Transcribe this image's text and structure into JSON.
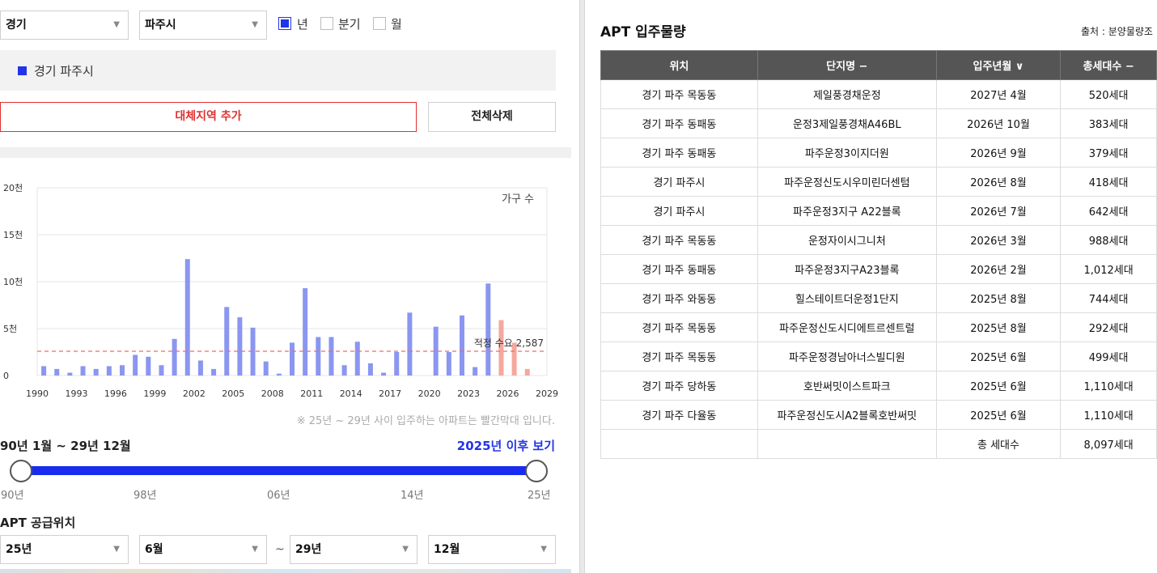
{
  "filters": {
    "province": "경기",
    "city": "파주시",
    "period_options": [
      {
        "label": "년",
        "checked": true
      },
      {
        "label": "분기",
        "checked": false
      },
      {
        "label": "월",
        "checked": false
      }
    ]
  },
  "selected_region": "경기 파주시",
  "buttons": {
    "add_region": "대체지역 추가",
    "delete_all": "전체삭제"
  },
  "chart_data": {
    "type": "bar",
    "series_label": "가구 수",
    "y_tick_labels": [
      "0",
      "5천",
      "10천",
      "15천",
      "20천"
    ],
    "ylim": [
      0,
      20000
    ],
    "x_tick_labels": [
      "1990",
      "1993",
      "1996",
      "1999",
      "2002",
      "2005",
      "2008",
      "2011",
      "2014",
      "2017",
      "2020",
      "2023",
      "2026",
      "2029"
    ],
    "xlim": [
      1990,
      2029
    ],
    "x": [
      1990,
      1991,
      1992,
      1993,
      1994,
      1995,
      1996,
      1997,
      1998,
      1999,
      2000,
      2001,
      2002,
      2003,
      2004,
      2005,
      2006,
      2007,
      2008,
      2009,
      2010,
      2011,
      2012,
      2013,
      2014,
      2015,
      2016,
      2017,
      2018,
      2019,
      2020,
      2021,
      2022,
      2023,
      2024,
      2025,
      2026,
      2027
    ],
    "values": [
      1000,
      700,
      300,
      1000,
      700,
      1000,
      1100,
      2200,
      2000,
      1100,
      3900,
      12400,
      1600,
      700,
      7300,
      6200,
      5100,
      1500,
      200,
      3500,
      9300,
      4100,
      4100,
      1100,
      3600,
      1300,
      300,
      2500,
      6700,
      0,
      5200,
      2500,
      6400,
      900,
      9800,
      5900,
      3500,
      700
    ],
    "colors": {
      "before_2025": "#8a96f0",
      "from_2025": "#f5a89c",
      "threshold": "#f06a6a"
    },
    "threshold": {
      "label": "적정 수요 2,587",
      "value": 2587
    }
  },
  "note": "※ 25년 ~ 29년 사이 입주하는 아파트는 빨간막대 입니다.",
  "range": {
    "title": "90년 1월 ~ 29년 12월",
    "link": "2025년 이후 보기",
    "tick_labels": [
      "90년",
      "98년",
      "06년",
      "14년",
      "25년"
    ]
  },
  "supply": {
    "title": "APT 공급위치",
    "start_year": "25년",
    "start_month": "6월",
    "tilde": "~",
    "end_year": "29년",
    "end_month": "12월"
  },
  "apt": {
    "title": "APT 입주물량",
    "source": "출처 : 분양물량조",
    "columns": [
      "위치",
      "단지명 −",
      "입주년월 ∨",
      "총세대수 −"
    ],
    "rows": [
      [
        "경기 파주 목동동",
        "제일풍경채운정",
        "2027년 4월",
        "520세대"
      ],
      [
        "경기 파주 동패동",
        "운정3제일풍경채A46BL",
        "2026년 10월",
        "383세대"
      ],
      [
        "경기 파주 동패동",
        "파주운정3이지더원",
        "2026년 9월",
        "379세대"
      ],
      [
        "경기 파주시",
        "파주운정신도시우미린더센텀",
        "2026년 8월",
        "418세대"
      ],
      [
        "경기 파주시",
        "파주운정3지구 A22블록",
        "2026년 7월",
        "642세대"
      ],
      [
        "경기 파주 목동동",
        "운정자이시그니처",
        "2026년 3월",
        "988세대"
      ],
      [
        "경기 파주 동패동",
        "파주운정3지구A23블록",
        "2026년 2월",
        "1,012세대"
      ],
      [
        "경기 파주 와동동",
        "힐스테이트더운정1단지",
        "2025년 8월",
        "744세대"
      ],
      [
        "경기 파주 목동동",
        "파주운정신도시디에트르센트럴",
        "2025년 8월",
        "292세대"
      ],
      [
        "경기 파주 목동동",
        "파주운정경남아너스빌디원",
        "2025년 6월",
        "499세대"
      ],
      [
        "경기 파주 당하동",
        "호반써밋이스트파크",
        "2025년 6월",
        "1,110세대"
      ],
      [
        "경기 파주 다율동",
        "파주운정신도시A2블록호반써밋",
        "2025년 6월",
        "1,110세대"
      ]
    ],
    "total_label": "총 세대수",
    "total_value": "8,097세대"
  }
}
